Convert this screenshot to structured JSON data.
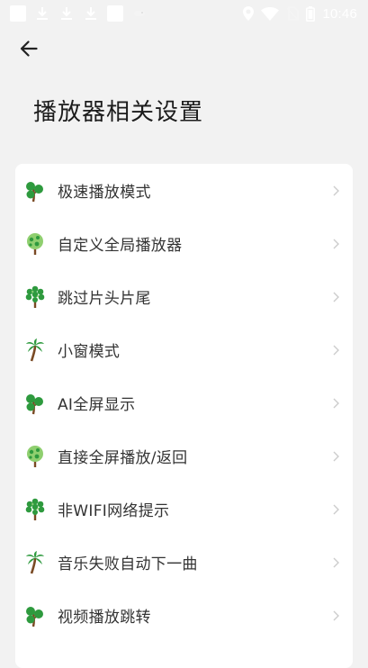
{
  "status_bar": {
    "time": "10:46",
    "icons": [
      "notification-square",
      "download-icon",
      "download-icon",
      "download-icon",
      "notification-square",
      "game-controller-icon",
      "location-icon",
      "wifi-icon",
      "no-sim-icon",
      "battery-icon"
    ]
  },
  "header": {
    "back_icon": "arrow-left-icon",
    "title": "播放器相关设置"
  },
  "settings": {
    "items": [
      {
        "label": "极速播放模式",
        "icon": "tree-round-icon"
      },
      {
        "label": "自定义全局播放器",
        "icon": "tree-light-icon"
      },
      {
        "label": "跳过片头片尾",
        "icon": "tree-bushy-icon"
      },
      {
        "label": "小窗模式",
        "icon": "palm-tree-icon"
      },
      {
        "label": "AI全屏显示",
        "icon": "tree-round-icon"
      },
      {
        "label": "直接全屏播放/返回",
        "icon": "tree-light-icon"
      },
      {
        "label": "非WIFI网络提示",
        "icon": "tree-bushy-icon"
      },
      {
        "label": "音乐失败自动下一曲",
        "icon": "palm-tree-icon"
      },
      {
        "label": "视频播放跳转",
        "icon": "tree-round-icon"
      }
    ]
  },
  "colors": {
    "background": "#f2f2f2",
    "card": "#ffffff",
    "leaf_dark": "#2e9a3e",
    "leaf_light": "#8fcf6f",
    "trunk": "#7a4a24",
    "chevron": "#cccccc"
  }
}
